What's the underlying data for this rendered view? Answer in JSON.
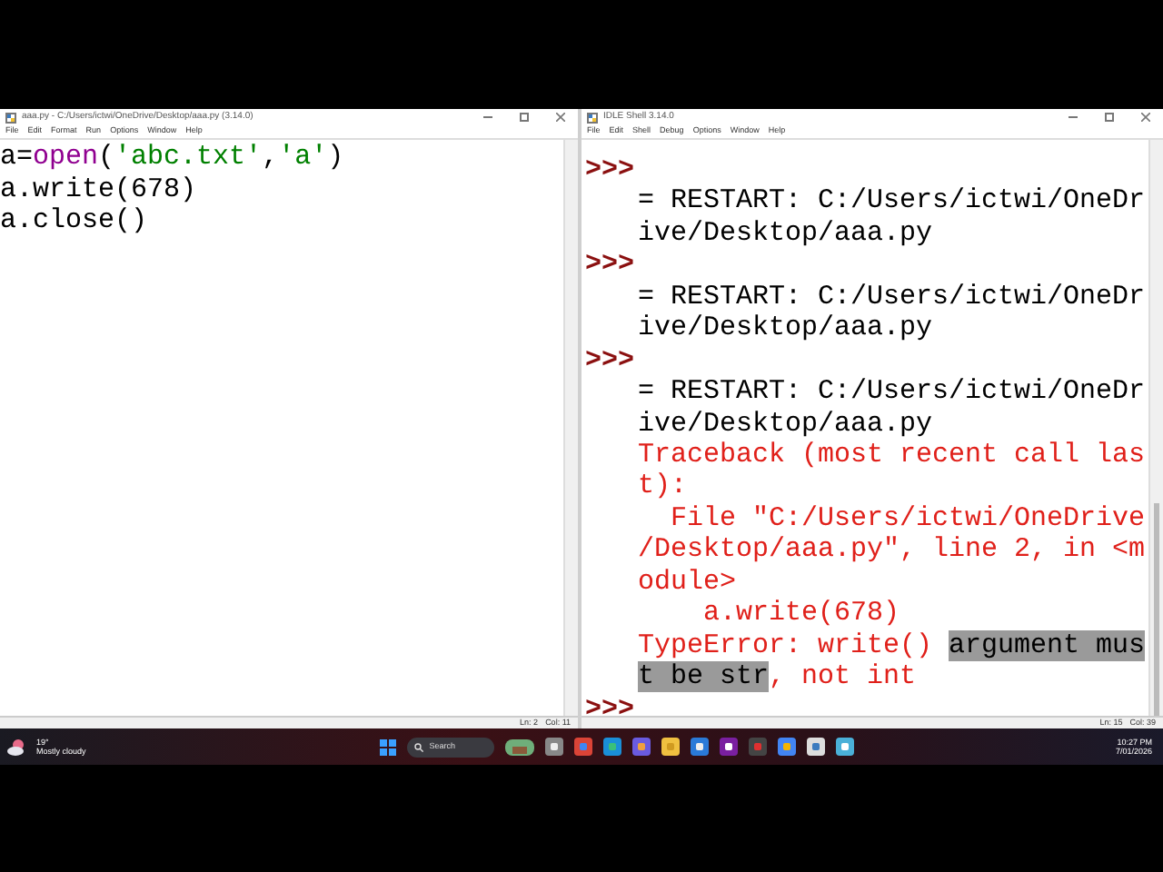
{
  "editor": {
    "title": "aaa.py - C:/Users/ictwi/OneDrive/Desktop/aaa.py (3.14.0)",
    "menu": [
      "File",
      "Edit",
      "Format",
      "Run",
      "Options",
      "Window",
      "Help"
    ],
    "lines": [
      [
        {
          "kind": "plain",
          "text": "a="
        },
        {
          "kind": "builtin",
          "text": "open"
        },
        {
          "kind": "plain",
          "text": "("
        },
        {
          "kind": "string",
          "text": "'abc.txt'"
        },
        {
          "kind": "plain",
          "text": ","
        },
        {
          "kind": "string",
          "text": "'a'"
        },
        {
          "kind": "plain",
          "text": ")"
        }
      ],
      [
        {
          "kind": "plain",
          "text": "a.write(678)"
        }
      ],
      [
        {
          "kind": "plain",
          "text": "a.close()"
        }
      ]
    ],
    "status": {
      "line": "Ln: 2",
      "col": "Col: 11"
    }
  },
  "shell": {
    "title": "IDLE Shell 3.14.0",
    "menu": [
      "File",
      "Edit",
      "Shell",
      "Debug",
      "Options",
      "Window",
      "Help"
    ],
    "lines": [
      {
        "kind": "prompt",
        "text": ">>>"
      },
      {
        "kind": "output",
        "text": "= RESTART: C:/Users/ictwi/OneDr"
      },
      {
        "kind": "output",
        "text": "ive/Desktop/aaa.py"
      },
      {
        "kind": "prompt",
        "text": ">>>"
      },
      {
        "kind": "output",
        "text": "= RESTART: C:/Users/ictwi/OneDr"
      },
      {
        "kind": "output",
        "text": "ive/Desktop/aaa.py"
      },
      {
        "kind": "prompt",
        "text": ">>>"
      },
      {
        "kind": "output",
        "text": "= RESTART: C:/Users/ictwi/OneDr"
      },
      {
        "kind": "output",
        "text": "ive/Desktop/aaa.py"
      },
      {
        "kind": "error",
        "text": "Traceback (most recent call las"
      },
      {
        "kind": "error",
        "text": "t):"
      },
      {
        "kind": "error",
        "text": "  File \"C:/Users/ictwi/OneDrive"
      },
      {
        "kind": "error",
        "text": "/Desktop/aaa.py\", line 2, in <m"
      },
      {
        "kind": "error",
        "text": "odule>"
      },
      {
        "kind": "error",
        "text": "    a.write(678)"
      },
      {
        "kind": "error",
        "segments": [
          {
            "text": "TypeError: write() ",
            "selected": false
          },
          {
            "text": "argument mus",
            "selected": true
          }
        ]
      },
      {
        "kind": "error",
        "segments": [
          {
            "text": "t be str",
            "selected": true
          },
          {
            "text": ", not int",
            "selected": false
          }
        ]
      },
      {
        "kind": "prompt",
        "text": ">>>"
      }
    ],
    "status": {
      "line": "Ln: 15",
      "col": "Col: 39"
    }
  },
  "taskbar": {
    "weather": {
      "temp": "19°",
      "text": "Mostly cloudy"
    },
    "search": {
      "placeholder": "Search"
    },
    "time": "10:27 PM",
    "date": "7/01/2026"
  }
}
